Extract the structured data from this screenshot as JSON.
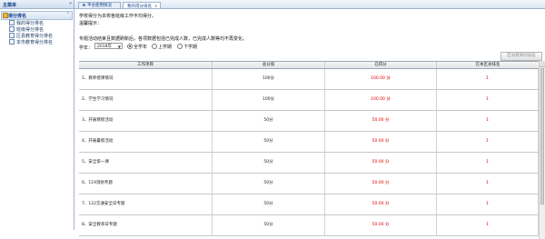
{
  "sidebar": {
    "header_title": "主菜单",
    "header_tools": "«",
    "section_title": "得分排名",
    "section_toggle": "⌃",
    "items": [
      {
        "label": "我的得分排名"
      },
      {
        "label": "班级得分排名"
      },
      {
        "label": "区县教育得分排名"
      },
      {
        "label": "本市教育得分排名"
      }
    ]
  },
  "tabs": [
    {
      "label": "平台使用情况",
      "closable": false
    },
    {
      "label": "我的得分排名",
      "closable": true
    }
  ],
  "main": {
    "intro": "学校得分为本校各班级工作平均得分。",
    "notice_title": "温馨提示：",
    "notice_text": "专题活动结束且数据刷新后，各项数据包括已完成人数，已完成人数等均不再变化。",
    "term_label": "学年：",
    "term_value": "2018年",
    "radio_options": [
      {
        "label": "全学年",
        "checked": true
      },
      {
        "label": "上学期",
        "checked": false
      },
      {
        "label": "下学期",
        "checked": false
      }
    ],
    "ranking_button": "区县教师的排名",
    "table": {
      "headers": [
        "工作项目",
        "总分值",
        "已得分",
        "在本区县排名"
      ],
      "rows": [
        {
          "item": "1、教师授课情况",
          "total": "100分",
          "got": "100.00 分",
          "rank": "1"
        },
        {
          "item": "2、学生学习情况",
          "total": "100分",
          "got": "100.00 分",
          "rank": "1"
        },
        {
          "item": "3、开展寒假活动",
          "total": "50分",
          "got": "50.00 分",
          "rank": "1"
        },
        {
          "item": "4、开展暑假活动",
          "total": "50分",
          "got": "50.00 分",
          "rank": "1"
        },
        {
          "item": "5、安全第一课",
          "total": "50分",
          "got": "50.00 分",
          "rank": "1"
        },
        {
          "item": "6、119消防专题",
          "total": "50分",
          "got": "50.00 分",
          "rank": "1"
        },
        {
          "item": "7、122交通安全日专题",
          "total": "50分",
          "got": "50.00 分",
          "rank": "1"
        },
        {
          "item": "8、安全教育日专题",
          "total": "50分",
          "got": "50.00 分",
          "rank": "1"
        }
      ]
    }
  },
  "colors": {
    "accent": "#15428b",
    "score_red": "#e00000",
    "border_blue": "#9fb4cd"
  }
}
